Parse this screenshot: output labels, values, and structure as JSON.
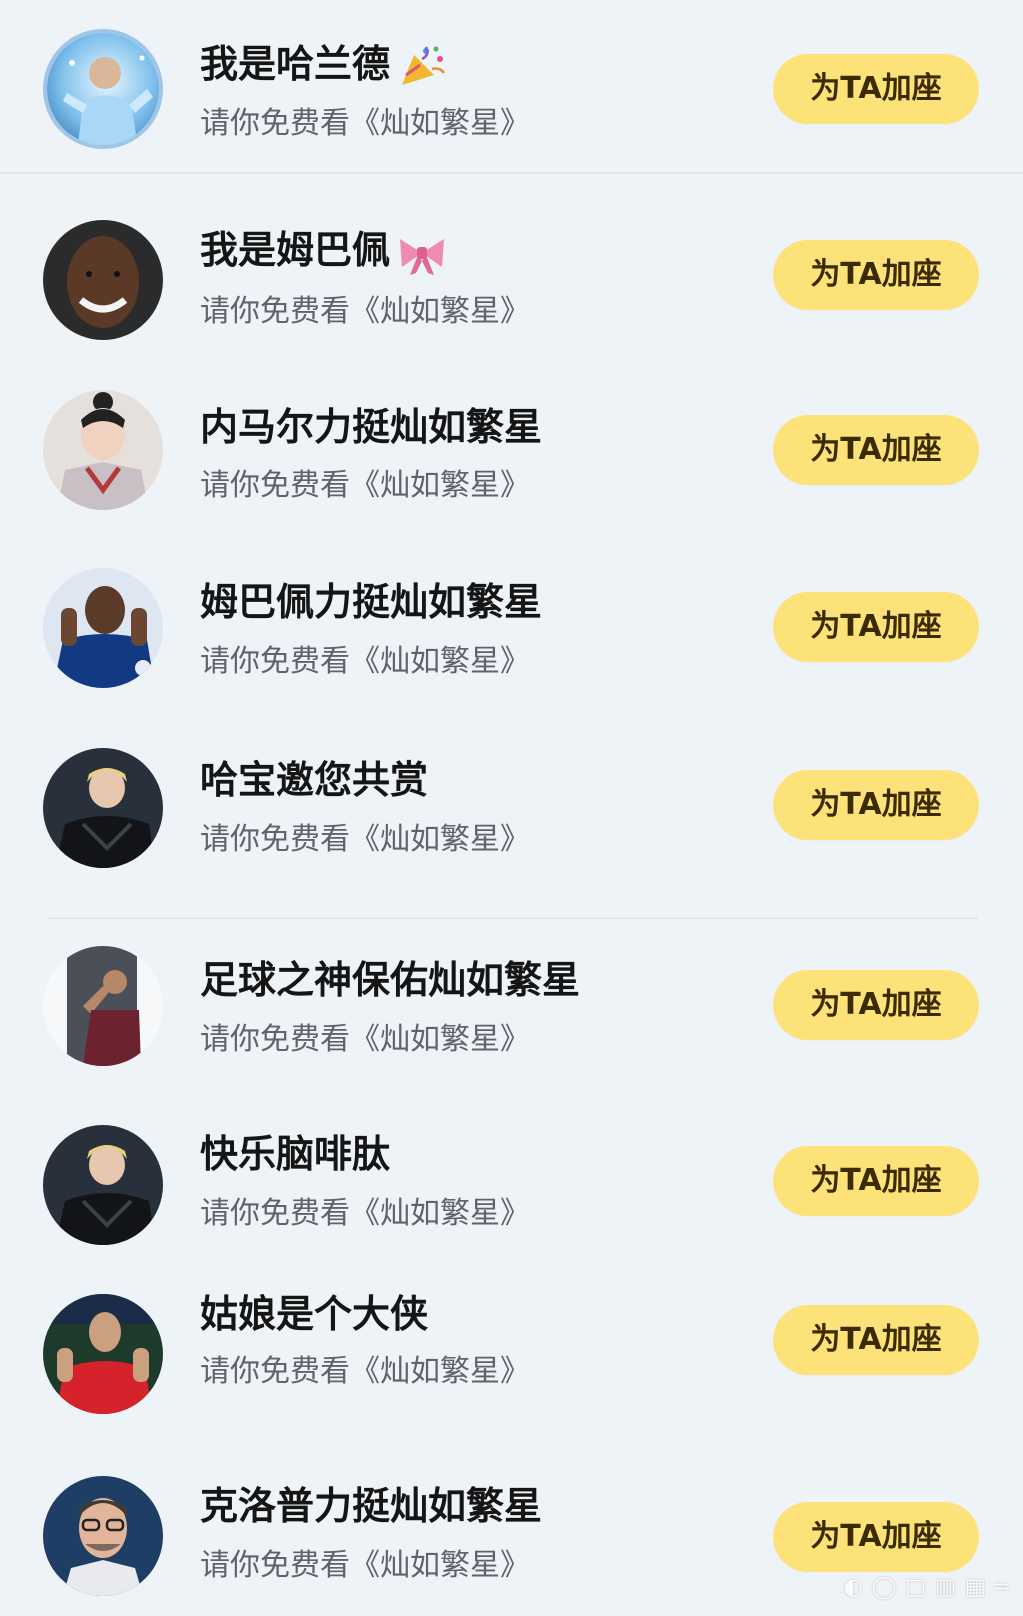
{
  "items": [
    {
      "name": "我是哈兰德",
      "emoji_icon": "party-popper-icon",
      "subtitle": "请你免费看《灿如繁星》",
      "button": "为TA加座",
      "avatar": "blue-holographic-player-avatar"
    },
    {
      "name": "我是姆巴佩",
      "emoji_icon": "pink-bow-icon",
      "subtitle": "请你免费看《灿如繁星》",
      "button": "为TA加座",
      "avatar": "smiling-man-portrait-avatar"
    },
    {
      "name": "内马尔力挺灿如繁星",
      "subtitle": "请你免费看《灿如繁星》",
      "button": "为TA加座",
      "avatar": "girl-with-hair-bun-avatar"
    },
    {
      "name": "姆巴佩力挺灿如繁星",
      "subtitle": "请你免费看《灿如繁星》",
      "button": "为TA加座",
      "avatar": "player-blue-kit-avatar"
    },
    {
      "name": "哈宝邀您共赏",
      "subtitle": "请你免费看《灿如繁星》",
      "button": "为TA加座",
      "avatar": "blond-man-dark-jacket-avatar"
    },
    {
      "name": "足球之神保佑灿如繁星",
      "subtitle": "请你免费看《灿如繁星》",
      "button": "为TA加座",
      "avatar": "player-celebrating-avatar"
    },
    {
      "name": "快乐脑啡肽",
      "subtitle": "请你免费看《灿如繁星》",
      "button": "为TA加座",
      "avatar": "blond-man-dark-jacket-avatar"
    },
    {
      "name": "姑娘是个大侠",
      "subtitle": "请你免费看《灿如繁星》",
      "button": "为TA加座",
      "avatar": "player-red-kit-clapping-avatar"
    },
    {
      "name": "克洛普力挺灿如繁星",
      "subtitle": "请你免费看《灿如繁星》",
      "button": "为TA加座",
      "avatar": "coach-with-glasses-avatar"
    }
  ],
  "watermark": "◐ ◯ □ ▥ ▦ ═",
  "colors": {
    "background": "#eef3f7",
    "button_bg": "#fde27a",
    "title_text": "#151515",
    "subtitle_text": "#5f636a"
  }
}
